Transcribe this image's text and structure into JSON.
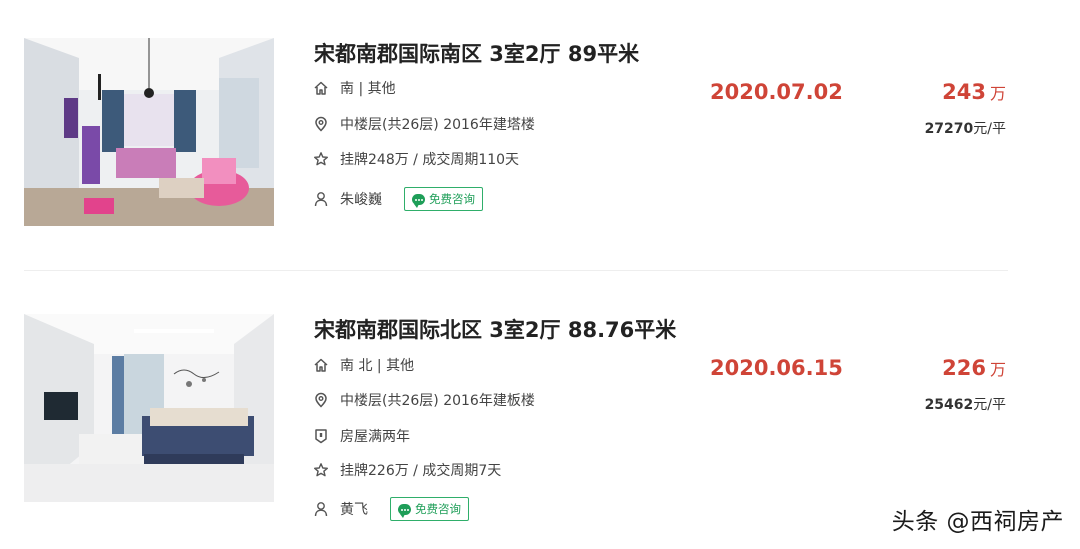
{
  "listings": [
    {
      "title": "宋都南郡国际南区 3室2厅 89平米",
      "orientation": "南 | 其他",
      "floor_info": "中楼层(共26层) 2016年建塔楼",
      "listing_info": "挂牌248万 / 成交周期110天",
      "agent": "朱峻巍",
      "consult_label": "免费咨询",
      "deal_date": "2020.07.02",
      "total_price": "243",
      "total_price_unit": "万",
      "unit_price": "27270",
      "unit_price_suffix": "元/平",
      "icons": [
        "home-icon",
        "location-icon",
        "star-icon",
        "person-icon",
        "chat-icon"
      ]
    },
    {
      "title": "宋都南郡国际北区 3室2厅 88.76平米",
      "orientation": "南 北 | 其他",
      "floor_info": "中楼层(共26层) 2016年建板楼",
      "tag": "房屋满两年",
      "listing_info": "挂牌226万 / 成交周期7天",
      "agent": "黄飞",
      "consult_label": "免费咨询",
      "deal_date": "2020.06.15",
      "total_price": "226",
      "total_price_unit": "万",
      "unit_price": "25462",
      "unit_price_suffix": "元/平",
      "icons": [
        "home-icon",
        "location-icon",
        "shield-icon",
        "star-icon",
        "person-icon",
        "chat-icon"
      ]
    }
  ],
  "watermark": "头条 @西祠房产",
  "colors": {
    "accent_red": "#cf4437",
    "consult_green": "#1e9e58",
    "divider": "#eeeeee"
  }
}
